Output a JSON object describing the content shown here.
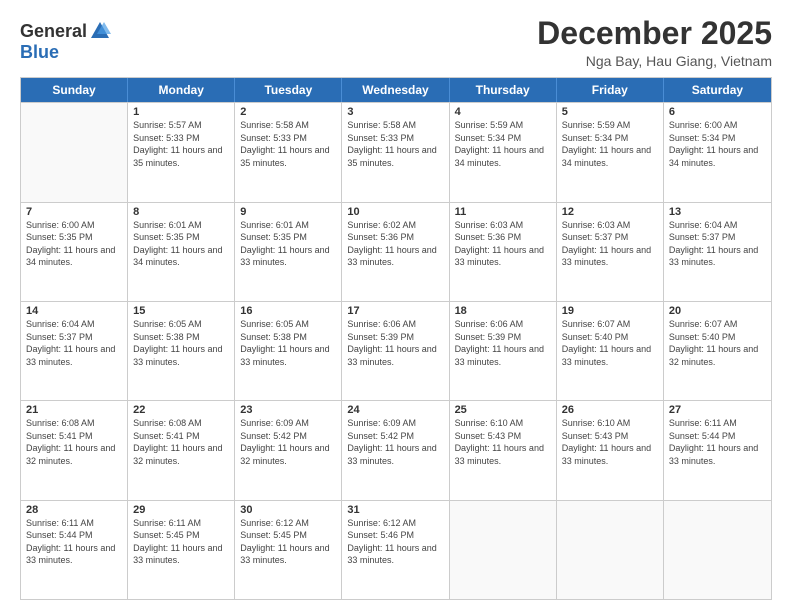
{
  "logo": {
    "general": "General",
    "blue": "Blue"
  },
  "header": {
    "month": "December 2025",
    "location": "Nga Bay, Hau Giang, Vietnam"
  },
  "days": [
    "Sunday",
    "Monday",
    "Tuesday",
    "Wednesday",
    "Thursday",
    "Friday",
    "Saturday"
  ],
  "weeks": [
    [
      {
        "day": "",
        "sunrise": "",
        "sunset": "",
        "daylight": ""
      },
      {
        "day": "1",
        "sunrise": "Sunrise: 5:57 AM",
        "sunset": "Sunset: 5:33 PM",
        "daylight": "Daylight: 11 hours and 35 minutes."
      },
      {
        "day": "2",
        "sunrise": "Sunrise: 5:58 AM",
        "sunset": "Sunset: 5:33 PM",
        "daylight": "Daylight: 11 hours and 35 minutes."
      },
      {
        "day": "3",
        "sunrise": "Sunrise: 5:58 AM",
        "sunset": "Sunset: 5:33 PM",
        "daylight": "Daylight: 11 hours and 35 minutes."
      },
      {
        "day": "4",
        "sunrise": "Sunrise: 5:59 AM",
        "sunset": "Sunset: 5:34 PM",
        "daylight": "Daylight: 11 hours and 34 minutes."
      },
      {
        "day": "5",
        "sunrise": "Sunrise: 5:59 AM",
        "sunset": "Sunset: 5:34 PM",
        "daylight": "Daylight: 11 hours and 34 minutes."
      },
      {
        "day": "6",
        "sunrise": "Sunrise: 6:00 AM",
        "sunset": "Sunset: 5:34 PM",
        "daylight": "Daylight: 11 hours and 34 minutes."
      }
    ],
    [
      {
        "day": "7",
        "sunrise": "Sunrise: 6:00 AM",
        "sunset": "Sunset: 5:35 PM",
        "daylight": "Daylight: 11 hours and 34 minutes."
      },
      {
        "day": "8",
        "sunrise": "Sunrise: 6:01 AM",
        "sunset": "Sunset: 5:35 PM",
        "daylight": "Daylight: 11 hours and 34 minutes."
      },
      {
        "day": "9",
        "sunrise": "Sunrise: 6:01 AM",
        "sunset": "Sunset: 5:35 PM",
        "daylight": "Daylight: 11 hours and 33 minutes."
      },
      {
        "day": "10",
        "sunrise": "Sunrise: 6:02 AM",
        "sunset": "Sunset: 5:36 PM",
        "daylight": "Daylight: 11 hours and 33 minutes."
      },
      {
        "day": "11",
        "sunrise": "Sunrise: 6:03 AM",
        "sunset": "Sunset: 5:36 PM",
        "daylight": "Daylight: 11 hours and 33 minutes."
      },
      {
        "day": "12",
        "sunrise": "Sunrise: 6:03 AM",
        "sunset": "Sunset: 5:37 PM",
        "daylight": "Daylight: 11 hours and 33 minutes."
      },
      {
        "day": "13",
        "sunrise": "Sunrise: 6:04 AM",
        "sunset": "Sunset: 5:37 PM",
        "daylight": "Daylight: 11 hours and 33 minutes."
      }
    ],
    [
      {
        "day": "14",
        "sunrise": "Sunrise: 6:04 AM",
        "sunset": "Sunset: 5:37 PM",
        "daylight": "Daylight: 11 hours and 33 minutes."
      },
      {
        "day": "15",
        "sunrise": "Sunrise: 6:05 AM",
        "sunset": "Sunset: 5:38 PM",
        "daylight": "Daylight: 11 hours and 33 minutes."
      },
      {
        "day": "16",
        "sunrise": "Sunrise: 6:05 AM",
        "sunset": "Sunset: 5:38 PM",
        "daylight": "Daylight: 11 hours and 33 minutes."
      },
      {
        "day": "17",
        "sunrise": "Sunrise: 6:06 AM",
        "sunset": "Sunset: 5:39 PM",
        "daylight": "Daylight: 11 hours and 33 minutes."
      },
      {
        "day": "18",
        "sunrise": "Sunrise: 6:06 AM",
        "sunset": "Sunset: 5:39 PM",
        "daylight": "Daylight: 11 hours and 33 minutes."
      },
      {
        "day": "19",
        "sunrise": "Sunrise: 6:07 AM",
        "sunset": "Sunset: 5:40 PM",
        "daylight": "Daylight: 11 hours and 33 minutes."
      },
      {
        "day": "20",
        "sunrise": "Sunrise: 6:07 AM",
        "sunset": "Sunset: 5:40 PM",
        "daylight": "Daylight: 11 hours and 32 minutes."
      }
    ],
    [
      {
        "day": "21",
        "sunrise": "Sunrise: 6:08 AM",
        "sunset": "Sunset: 5:41 PM",
        "daylight": "Daylight: 11 hours and 32 minutes."
      },
      {
        "day": "22",
        "sunrise": "Sunrise: 6:08 AM",
        "sunset": "Sunset: 5:41 PM",
        "daylight": "Daylight: 11 hours and 32 minutes."
      },
      {
        "day": "23",
        "sunrise": "Sunrise: 6:09 AM",
        "sunset": "Sunset: 5:42 PM",
        "daylight": "Daylight: 11 hours and 32 minutes."
      },
      {
        "day": "24",
        "sunrise": "Sunrise: 6:09 AM",
        "sunset": "Sunset: 5:42 PM",
        "daylight": "Daylight: 11 hours and 33 minutes."
      },
      {
        "day": "25",
        "sunrise": "Sunrise: 6:10 AM",
        "sunset": "Sunset: 5:43 PM",
        "daylight": "Daylight: 11 hours and 33 minutes."
      },
      {
        "day": "26",
        "sunrise": "Sunrise: 6:10 AM",
        "sunset": "Sunset: 5:43 PM",
        "daylight": "Daylight: 11 hours and 33 minutes."
      },
      {
        "day": "27",
        "sunrise": "Sunrise: 6:11 AM",
        "sunset": "Sunset: 5:44 PM",
        "daylight": "Daylight: 11 hours and 33 minutes."
      }
    ],
    [
      {
        "day": "28",
        "sunrise": "Sunrise: 6:11 AM",
        "sunset": "Sunset: 5:44 PM",
        "daylight": "Daylight: 11 hours and 33 minutes."
      },
      {
        "day": "29",
        "sunrise": "Sunrise: 6:11 AM",
        "sunset": "Sunset: 5:45 PM",
        "daylight": "Daylight: 11 hours and 33 minutes."
      },
      {
        "day": "30",
        "sunrise": "Sunrise: 6:12 AM",
        "sunset": "Sunset: 5:45 PM",
        "daylight": "Daylight: 11 hours and 33 minutes."
      },
      {
        "day": "31",
        "sunrise": "Sunrise: 6:12 AM",
        "sunset": "Sunset: 5:46 PM",
        "daylight": "Daylight: 11 hours and 33 minutes."
      },
      {
        "day": "",
        "sunrise": "",
        "sunset": "",
        "daylight": ""
      },
      {
        "day": "",
        "sunrise": "",
        "sunset": "",
        "daylight": ""
      },
      {
        "day": "",
        "sunrise": "",
        "sunset": "",
        "daylight": ""
      }
    ]
  ]
}
